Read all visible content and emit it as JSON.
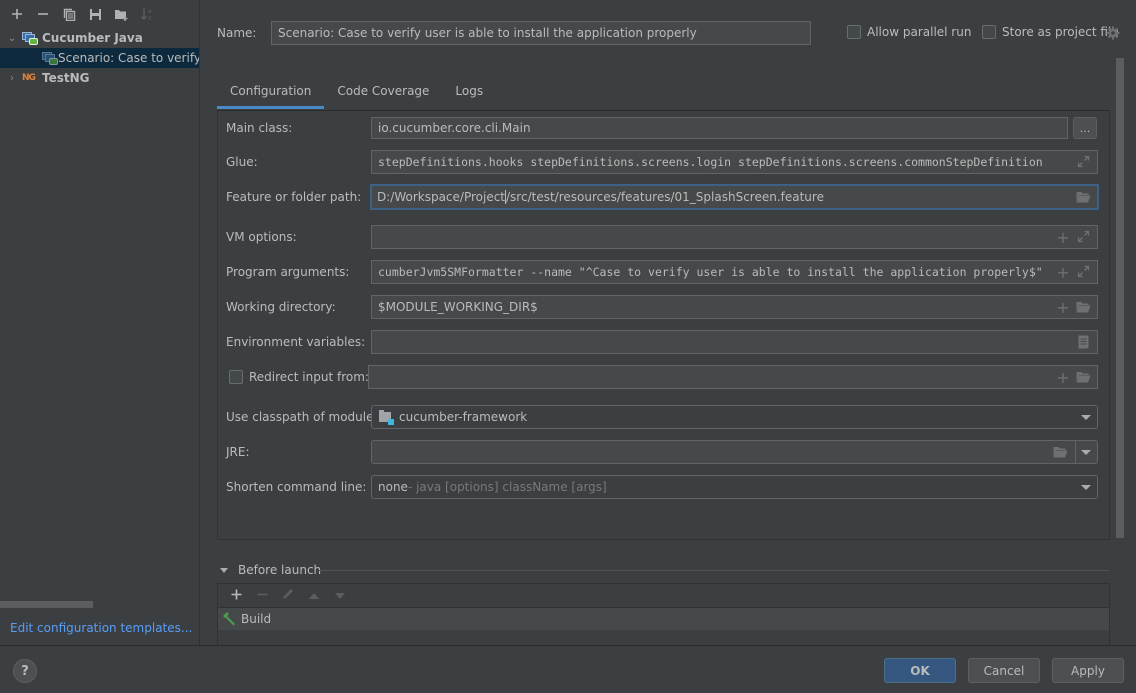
{
  "sidebar": {
    "toolbar": [
      {
        "name": "add-icon",
        "glyph": "+"
      },
      {
        "name": "remove-icon",
        "glyph": "−"
      },
      {
        "name": "copy-icon",
        "glyph": "⧉"
      },
      {
        "name": "save-icon",
        "glyph": "💾"
      },
      {
        "name": "new-folder-icon",
        "glyph": "📁"
      },
      {
        "name": "sort-icon",
        "glyph": "↓ᵃᶻ"
      }
    ],
    "tree": [
      {
        "label": "Cucumber Java",
        "expanded": true
      },
      {
        "label": "Scenario: Case to verify user is able to install the application properly",
        "selected": true
      },
      {
        "label": "TestNG",
        "expanded": false
      }
    ],
    "edit_templates_link": "Edit configuration templates..."
  },
  "header": {
    "name_label": "Name:",
    "name_value": "Scenario: Case to verify user is able to install the application properly",
    "allow_parallel_run": {
      "label": "Allow parallel run",
      "checked": false
    },
    "store_as_project_file": {
      "label": "Store as project file",
      "checked": false
    }
  },
  "tabs": [
    {
      "label": "Configuration",
      "active": true
    },
    {
      "label": "Code Coverage",
      "active": false
    },
    {
      "label": "Logs",
      "active": false
    }
  ],
  "form": {
    "main_class": {
      "label": "Main class:",
      "value": "io.cucumber.core.cli.Main",
      "button": "..."
    },
    "glue": {
      "label": "Glue:",
      "value": "stepDefinitions.hooks stepDefinitions.screens.login stepDefinitions.screens.commonStepDefinition"
    },
    "feature_path": {
      "label": "Feature or folder path:",
      "value_before_caret": "D:/Workspace/Project",
      "value_after_caret": "/src/test/resources/features/01_SplashScreen.feature"
    },
    "vm_options": {
      "label": "VM options:",
      "value": ""
    },
    "program_arguments": {
      "label": "Program arguments:",
      "value": "cumberJvm5SMFormatter --name \"^Case to verify user is able to install the application properly$\""
    },
    "working_directory": {
      "label": "Working directory:",
      "value": "$MODULE_WORKING_DIR$"
    },
    "environment_variables": {
      "label": "Environment variables:",
      "value": ""
    },
    "redirect_input": {
      "label": "Redirect input from:",
      "checked": false,
      "value": ""
    },
    "classpath_module": {
      "label": "Use classpath of module:",
      "value": "cucumber-framework"
    },
    "jre": {
      "label": "JRE:",
      "value": ""
    },
    "shorten_command_line": {
      "label": "Shorten command line:",
      "value": "none",
      "hint": " - java [options] className [args]"
    }
  },
  "before_launch": {
    "title": "Before launch",
    "items": [
      {
        "label": "Build"
      }
    ]
  },
  "footer": {
    "help": "?",
    "ok": "OK",
    "cancel": "Cancel",
    "apply": "Apply"
  },
  "colors": {
    "accent": "#4a88c7",
    "link": "#589df6",
    "primary_button": "#365880",
    "selection": "#0d293e"
  }
}
